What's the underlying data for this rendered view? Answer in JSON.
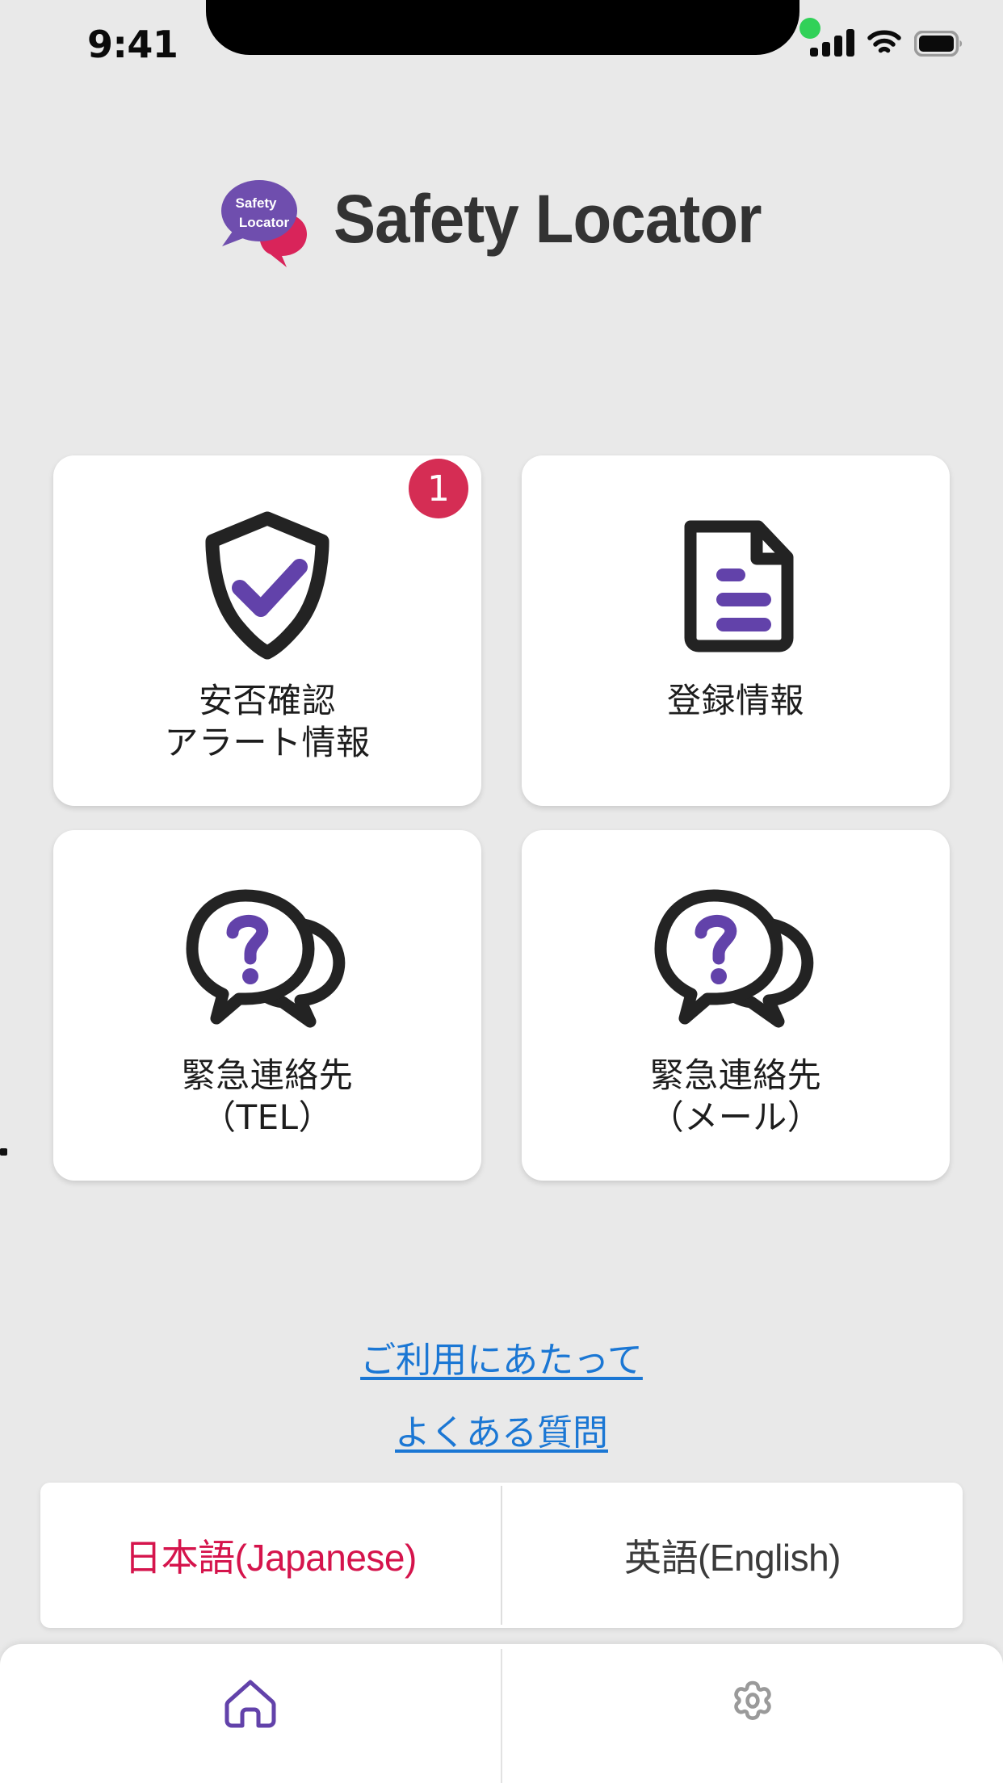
{
  "status_bar": {
    "time": "9:41",
    "icons": [
      "recording-dot",
      "cellular-signal",
      "wifi",
      "battery"
    ],
    "recording_dot_color": "#31d158"
  },
  "header": {
    "title": "Safety Locator",
    "title_color": "#333333",
    "logo": {
      "name": "safety-locator-logo",
      "bubble_primary_color": "#6f4eae",
      "bubble_secondary_color": "#d9245a",
      "line1": "Safety",
      "line2": "Locator"
    }
  },
  "theme": {
    "background": "#e9e9e9",
    "card_background": "#ffffff",
    "accent_purple": "#6242aa",
    "accent_crimson": "#d52d54",
    "link_blue": "#1b77d4",
    "icon_dark": "#2b2b2b"
  },
  "main": {
    "tiles": [
      {
        "id": "safety-confirmation-alert",
        "icon": "shield-check-icon",
        "label": "安否確認\nアラート情報",
        "label_line1": "安否確認",
        "label_line2": "アラート情報",
        "badge": "1"
      },
      {
        "id": "registration-info",
        "icon": "document-lines-icon",
        "label": "登録情報",
        "label_line1": "登録情報",
        "label_line2": "",
        "badge": ""
      },
      {
        "id": "emergency-contact-tel",
        "icon": "speech-bubbles-question-icon",
        "label": "緊急連絡先\n（TEL）",
        "label_line1": "緊急連絡先",
        "label_line2": "（TEL）",
        "badge": ""
      },
      {
        "id": "emergency-contact-mail",
        "icon": "speech-bubbles-question-icon",
        "label": "緊急連絡先\n（メール）",
        "label_line1": "緊急連絡先",
        "label_line2": "（メール）",
        "badge": ""
      }
    ]
  },
  "links": [
    {
      "id": "terms-of-use",
      "label": "ご利用にあたって"
    },
    {
      "id": "faq",
      "label": "よくある質問"
    }
  ],
  "language_switch": {
    "selected": "ja",
    "options": [
      {
        "id": "ja",
        "label": "日本語(Japanese)",
        "active": true
      },
      {
        "id": "en",
        "label": "英語(English)",
        "active": false
      }
    ]
  },
  "bottom_nav": {
    "items": [
      {
        "id": "home",
        "icon": "home-icon",
        "active": true,
        "color": "#6242aa"
      },
      {
        "id": "settings",
        "icon": "gear-icon",
        "active": false,
        "color": "#9a9a9a"
      }
    ]
  }
}
